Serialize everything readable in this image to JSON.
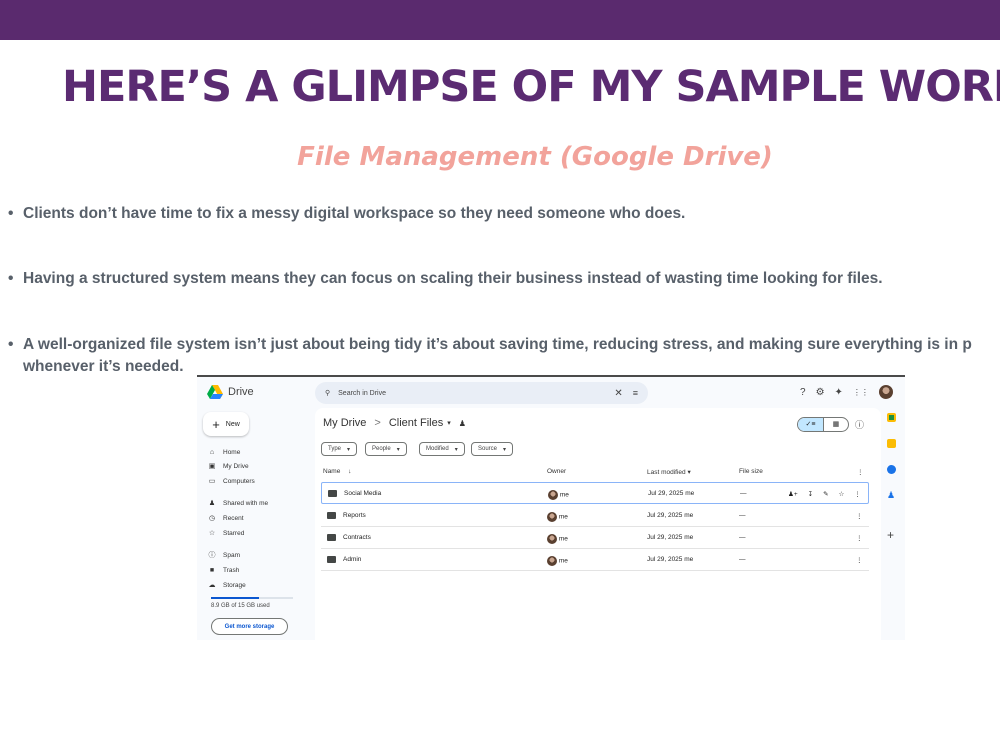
{
  "slide": {
    "headline": "HERE’S A GLIMPSE OF MY SAMPLE WORKS",
    "subtitle": "File Management (Google Drive)",
    "bullets": [
      "Clients don’t have time to fix a messy digital workspace so they need someone who does.",
      "Having a structured system means they can focus on scaling their business instead of wasting time looking for files.",
      "A well-organized file system isn’t just about being tidy it’s about saving time, reducing stress, and making sure everything is in p"
    ],
    "bullet3_line2": "whenever it’s needed.",
    "bullet_glyph": "•"
  },
  "drive": {
    "app_name": "Drive",
    "search": {
      "placeholder": "Search in Drive"
    },
    "new_label": "New",
    "nav": [
      {
        "label": "Home",
        "icon": "home-icon"
      },
      {
        "label": "My Drive",
        "icon": "my-drive-icon"
      },
      {
        "label": "Computers",
        "icon": "computers-icon"
      },
      {
        "label": "Shared with me",
        "icon": "people-icon"
      },
      {
        "label": "Recent",
        "icon": "clock-icon"
      },
      {
        "label": "Starred",
        "icon": "star-icon"
      },
      {
        "label": "Spam",
        "icon": "spam-icon"
      },
      {
        "label": "Trash",
        "icon": "trash-icon"
      },
      {
        "label": "Storage",
        "icon": "cloud-icon"
      }
    ],
    "storage_text": "8.9 GB of 15 GB used",
    "storage_fraction": 0.59,
    "get_storage_label": "Get more storage",
    "breadcrumb": {
      "root": "My Drive",
      "sep": ">",
      "current": "Client Files"
    },
    "filters": [
      "Type",
      "People",
      "Modified",
      "Source"
    ],
    "columns": {
      "name": "Name",
      "owner": "Owner",
      "modified": "Last modified",
      "size": "File size"
    },
    "files": [
      {
        "name": "Social Media",
        "owner": "me",
        "modified": "Jul 29, 2025 me",
        "size": "—"
      },
      {
        "name": "Reports",
        "owner": "me",
        "modified": "Jul 29, 2025 me",
        "size": "—"
      },
      {
        "name": "Contracts",
        "owner": "me",
        "modified": "Jul 29, 2025 me",
        "size": "—"
      },
      {
        "name": "Admin",
        "owner": "me",
        "modified": "Jul 29, 2025 me",
        "size": "—"
      }
    ],
    "colors": {
      "brand_purple": "#5a2a6e",
      "accent_pink": "#f2a39b",
      "drive_blue": "#0b57d0"
    }
  }
}
